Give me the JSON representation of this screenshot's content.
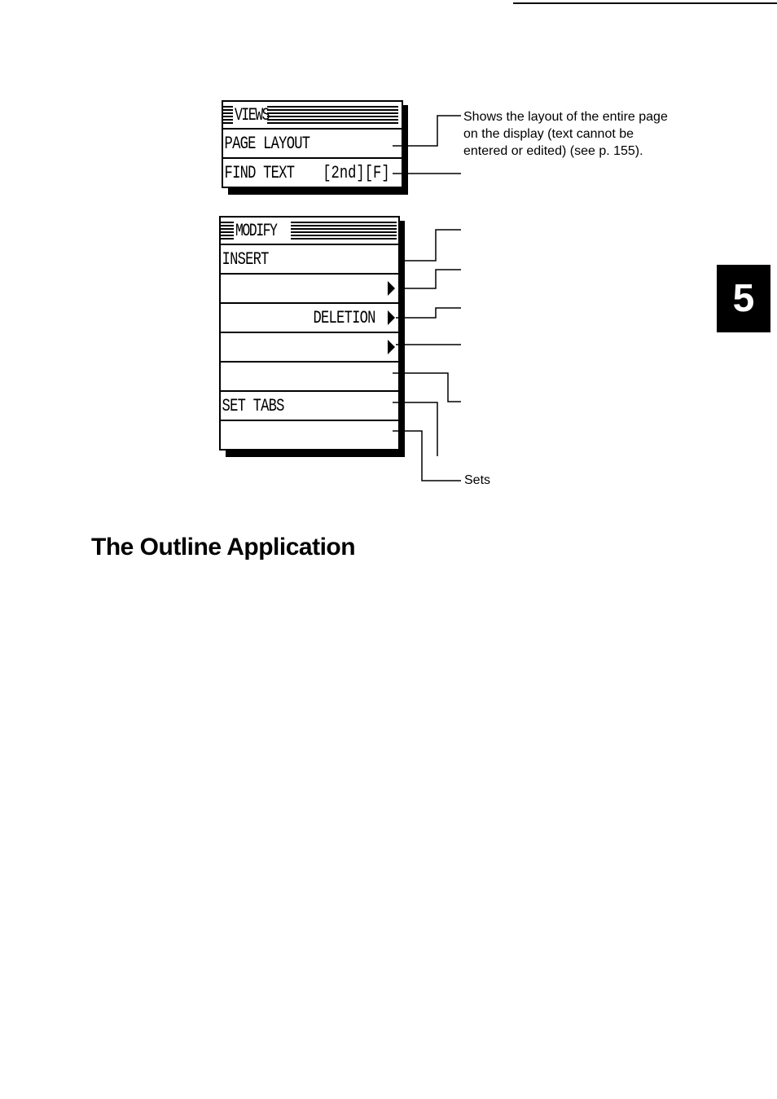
{
  "page": {
    "chapter_tab": "5",
    "section_heading": "The Outline Application"
  },
  "views_menu": {
    "title": "VIEWS",
    "items": [
      {
        "label": "PAGE LAYOUT",
        "shortcut": "",
        "submenu": false
      },
      {
        "label": "FIND TEXT",
        "shortcut": "[2nd][F]",
        "submenu": false
      }
    ]
  },
  "modify_menu": {
    "title": "MODIFY",
    "items": [
      {
        "label": "INSERT",
        "submenu": false
      },
      {
        "label": "",
        "submenu": true
      },
      {
        "label": "DELETION",
        "submenu": true
      },
      {
        "label": "",
        "submenu": true
      },
      {
        "label": "",
        "submenu": false
      },
      {
        "label": "SET TABS",
        "submenu": false
      },
      {
        "label": "",
        "submenu": false
      }
    ]
  },
  "callouts": {
    "page_layout": "Shows the layout of the entire page on the display (text cannot be entered or edited) (see p. 155).",
    "page_layout_lines": [
      "Shows the layout of the entire page",
      "on the display (text cannot be",
      "entered or edited) (see p. 155)."
    ],
    "sets": "Sets"
  }
}
